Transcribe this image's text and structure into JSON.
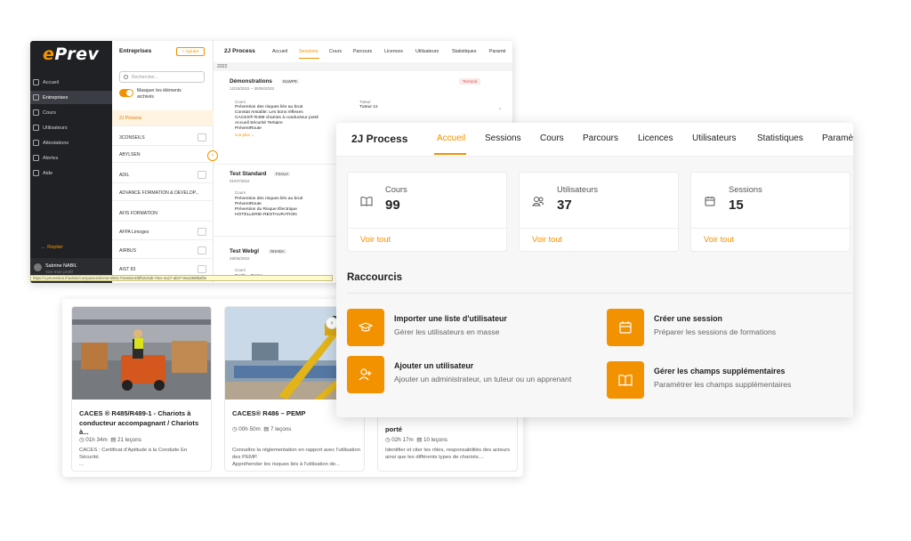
{
  "back_app": {
    "logo": {
      "e": "e",
      "rest": "Prev"
    },
    "nav": [
      "Accueil",
      "Entreprises",
      "Cours",
      "Utilisateurs",
      "Attestations",
      "Alertes",
      "Aide"
    ],
    "collapse": "← Replier",
    "user": {
      "name": "Sabrine NABIL",
      "link": "Voir mon profil"
    },
    "status_url": "https://v.prevention.fr/admin/companies/element/5617/sessions/8f52c0ab-74ec-4a17-ab47-0ea2369baf0e",
    "list": {
      "title": "Entreprises",
      "add": "+ Ajouter",
      "search_placeholder": "Rechercher...",
      "toggle_label": "Masquer les éléments archivés",
      "items": [
        "2J Process",
        "3CONSEILS",
        "ABYLSEN",
        "ADIL",
        "ADVANCE FORMATION & DEVELOP...",
        "AFIS FORMATION",
        "AFPA Limoges",
        "AIRBUS",
        "AIST 83"
      ]
    },
    "main": {
      "title": "2J Process",
      "tabs": [
        "Accueil",
        "Sessions",
        "Cours",
        "Parcours",
        "Licences",
        "Utilisateurs",
        "Statistiques",
        "Paramè"
      ],
      "year": "2022",
      "sessions": [
        {
          "title": "Démonstrations",
          "code": "N1WPR",
          "date": "12/10/2022 – 30/06/2023",
          "badge": "Terminé",
          "courses_label": "Cours",
          "courses": [
            "Prévention des risques liés au bruit",
            "Constat Amiable: Les bons réflexes",
            "CACES® R489 chariots à conducteur porté",
            "Accueil Sécurité Tertiaire",
            "PréventRoute"
          ],
          "more": "voir plus ⌄",
          "tutor_label": "Tuteur",
          "tutor": "Tuteur 2J"
        },
        {
          "title": "Test Standard",
          "code": "F2AUA",
          "date": "01/07/2022",
          "courses_label": "Cours",
          "courses": [
            "Prévention des risques liés au bruit",
            "PréventRoute",
            "Prévention du Risque Électrique",
            "HOTELLERIE-RESTAURATION"
          ]
        },
        {
          "title": "Test Webgl",
          "code": "RHHDA",
          "date": "29/06/2022",
          "courses_label": "Cours",
          "courses": [
            "Ecobi – Game"
          ]
        }
      ]
    }
  },
  "courses_panel": {
    "cards": [
      {
        "title": "CACES ® R485/R489-1 - Chariots à conducteur accompagnant / Chariots à...",
        "duration": "01h 34m",
        "lessons": "21 leçons",
        "desc": "CACES : Certificat d'Aptitude à la Conduite En Sécurité.\n..."
      },
      {
        "title": "CACES® R486 – PEMP",
        "duration": "00h 50m",
        "lessons": "7 leçons",
        "desc": "Connaître la réglementation en rapport avec l'utilisation des PEMP.\nAppréhender les risques liés à l'utilisation de..."
      },
      {
        "title": "porté",
        "duration": "02h 17m",
        "lessons": "10 leçons",
        "desc": "Identifier et citer les rôles, responsabilités des acteurs ainsi que les différents types de chariots...."
      }
    ]
  },
  "front": {
    "title": "2J Process",
    "tabs": [
      "Accueil",
      "Sessions",
      "Cours",
      "Parcours",
      "Licences",
      "Utilisateurs",
      "Statistiques",
      "Paramè"
    ],
    "stats": [
      {
        "label": "Cours",
        "value": "99",
        "link": "Voir tout",
        "icon": "book-icon"
      },
      {
        "label": "Utilisateurs",
        "value": "37",
        "link": "Voir tout",
        "icon": "users-icon"
      },
      {
        "label": "Sessions",
        "value": "15",
        "link": "Voir tout",
        "icon": "calendar-icon"
      }
    ],
    "shortcuts_title": "Raccourcis",
    "shortcuts": [
      {
        "title": "Importer une liste d'utilisateur",
        "desc": "Gérer les utilisateurs en masse",
        "icon": "graduation-cap-icon"
      },
      {
        "title": "Créer une session",
        "desc": "Préparer les sessions de formations",
        "icon": "calendar-icon"
      },
      {
        "title": "Ajouter un utilisateur",
        "desc": "Ajouter un administrateur, un tuteur ou un apprenant",
        "icon": "add-user-icon"
      },
      {
        "title": "Gérer les champs supplémentaires",
        "desc": "Paramétrer les champs supplémentaires",
        "icon": "book-icon"
      }
    ],
    "accent": "#f39200"
  }
}
